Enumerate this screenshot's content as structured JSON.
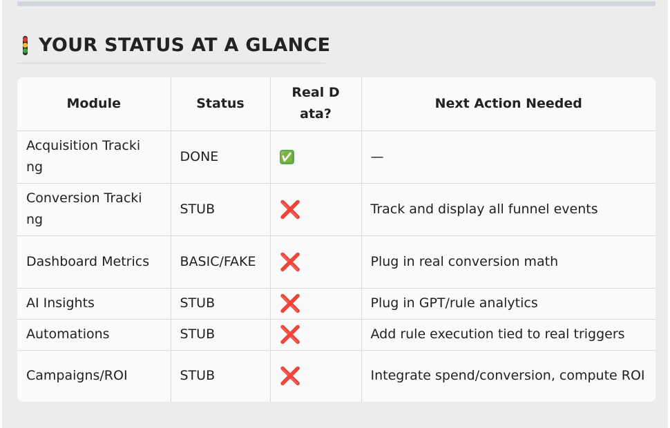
{
  "heading": {
    "icon": "traffic-light-icon",
    "title": "YOUR STATUS AT A GLANCE"
  },
  "colors": {
    "background": "#ececec",
    "table_background": "#fafafa",
    "check": "#4caf50",
    "cross": "#e23a2e",
    "light_red": "#e53935",
    "light_yellow": "#fbc02d",
    "light_green": "#43a047"
  },
  "table": {
    "headers": [
      "Module",
      "Status",
      "Real Data?",
      "Next Action Needed"
    ],
    "rows": [
      {
        "module": "Acquisition Tracking",
        "status": "DONE",
        "real_data": "✅",
        "real_data_icon": "check-icon",
        "next_action": "—"
      },
      {
        "module": "Conversion Tracking",
        "status": "STUB",
        "real_data": "❌",
        "real_data_icon": "cross-icon",
        "next_action": "Track and display all funnel events"
      },
      {
        "module": "Dashboard Metrics",
        "status": "BASIC/FAKE",
        "real_data": "❌",
        "real_data_icon": "cross-icon",
        "next_action": "Plug in real conversion math"
      },
      {
        "module": "AI Insights",
        "status": "STUB",
        "real_data": "❌",
        "real_data_icon": "cross-icon",
        "next_action": "Plug in GPT/rule analytics"
      },
      {
        "module": "Automations",
        "status": "STUB",
        "real_data": "❌",
        "real_data_icon": "cross-icon",
        "next_action": "Add rule execution tied to real triggers"
      },
      {
        "module": "Campaigns/ROI",
        "status": "STUB",
        "real_data": "❌",
        "real_data_icon": "cross-icon",
        "next_action": "Integrate spend/conversion, compute ROI"
      }
    ]
  }
}
